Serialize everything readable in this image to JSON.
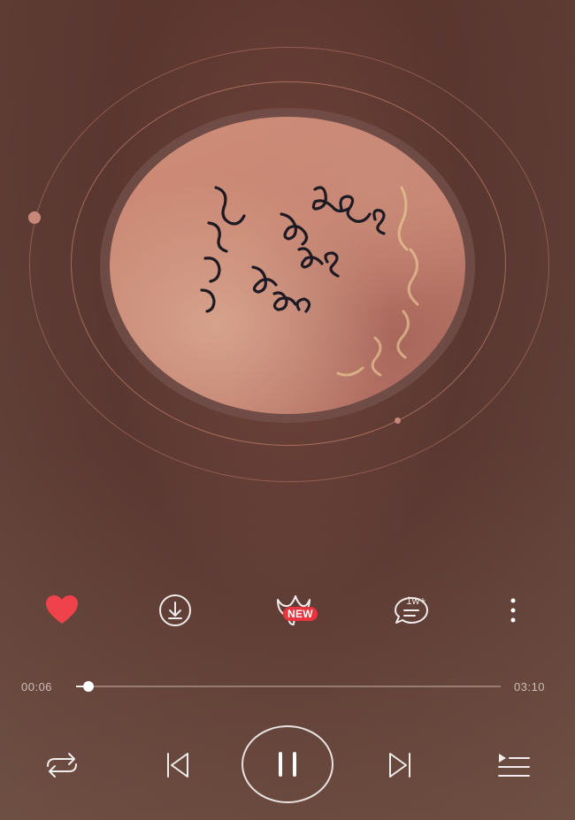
{
  "album": {
    "cover_icon": "album-artwork",
    "cover_handwriting": "Let's fall in love for the night",
    "cover_background_script": "for the night"
  },
  "actions": {
    "like_icon": "heart-icon",
    "like_color": "#f0424a",
    "download_icon": "download-icon",
    "vip_icon": "whale-tail-icon",
    "vip_badge": "NEW",
    "comment_icon": "comment-icon",
    "comment_count": "1w+",
    "more_icon": "more-vertical-icon"
  },
  "progress": {
    "current_time": "00:06",
    "total_time": "03:10",
    "played_fraction": 0.03
  },
  "controls": {
    "repeat_icon": "repeat-icon",
    "prev_icon": "skip-previous-icon",
    "play_pause_icon": "pause-icon",
    "next_icon": "skip-next-icon",
    "playlist_icon": "playlist-icon"
  }
}
